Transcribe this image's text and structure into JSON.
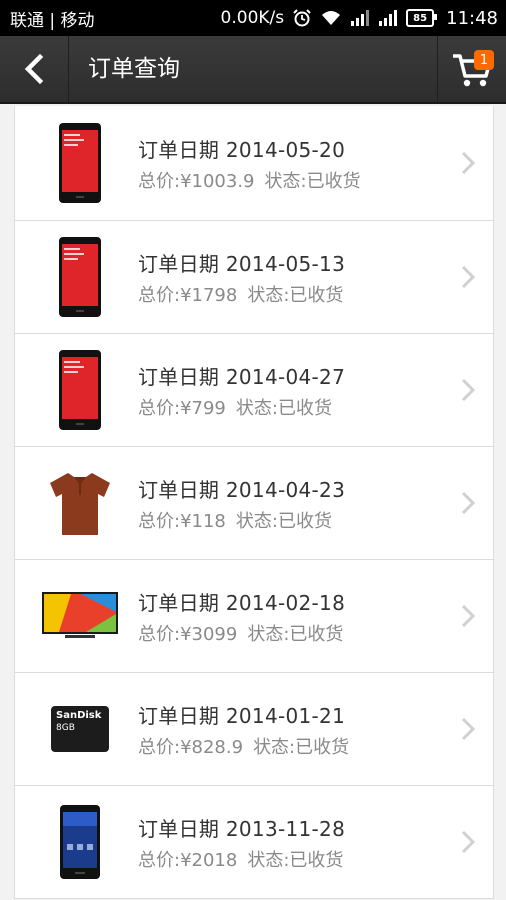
{
  "status_bar": {
    "carrier": "联通 | 移动",
    "speed": "0.00K/s",
    "battery": "85",
    "time": "11:48",
    "icons": [
      "alarm-icon",
      "wifi-icon",
      "signal-icon",
      "signal-icon"
    ]
  },
  "header": {
    "title": "订单查询",
    "cart_badge": "1"
  },
  "labels": {
    "date_prefix": "订单日期",
    "total_prefix": "总价:",
    "status_prefix": "状态:"
  },
  "orders": [
    {
      "date": "2014-05-20",
      "total": "¥1003.9",
      "status": "已收货",
      "thumb": "red-phone"
    },
    {
      "date": "2014-05-13",
      "total": "¥1798",
      "status": "已收货",
      "thumb": "red-phone"
    },
    {
      "date": "2014-04-27",
      "total": "¥799",
      "status": "已收货",
      "thumb": "red-phone"
    },
    {
      "date": "2014-04-23",
      "total": "¥118",
      "status": "已收货",
      "thumb": "polo-shirt"
    },
    {
      "date": "2014-02-18",
      "total": "¥3099",
      "status": "已收货",
      "thumb": "tv"
    },
    {
      "date": "2014-01-21",
      "total": "¥828.9",
      "status": "已收货",
      "thumb": "sd-card"
    },
    {
      "date": "2013-11-28",
      "total": "¥2018",
      "status": "已收货",
      "thumb": "black-phone"
    }
  ],
  "thumb_text": {
    "sd_brand": "SanDisk",
    "sd_size": "8GB"
  }
}
